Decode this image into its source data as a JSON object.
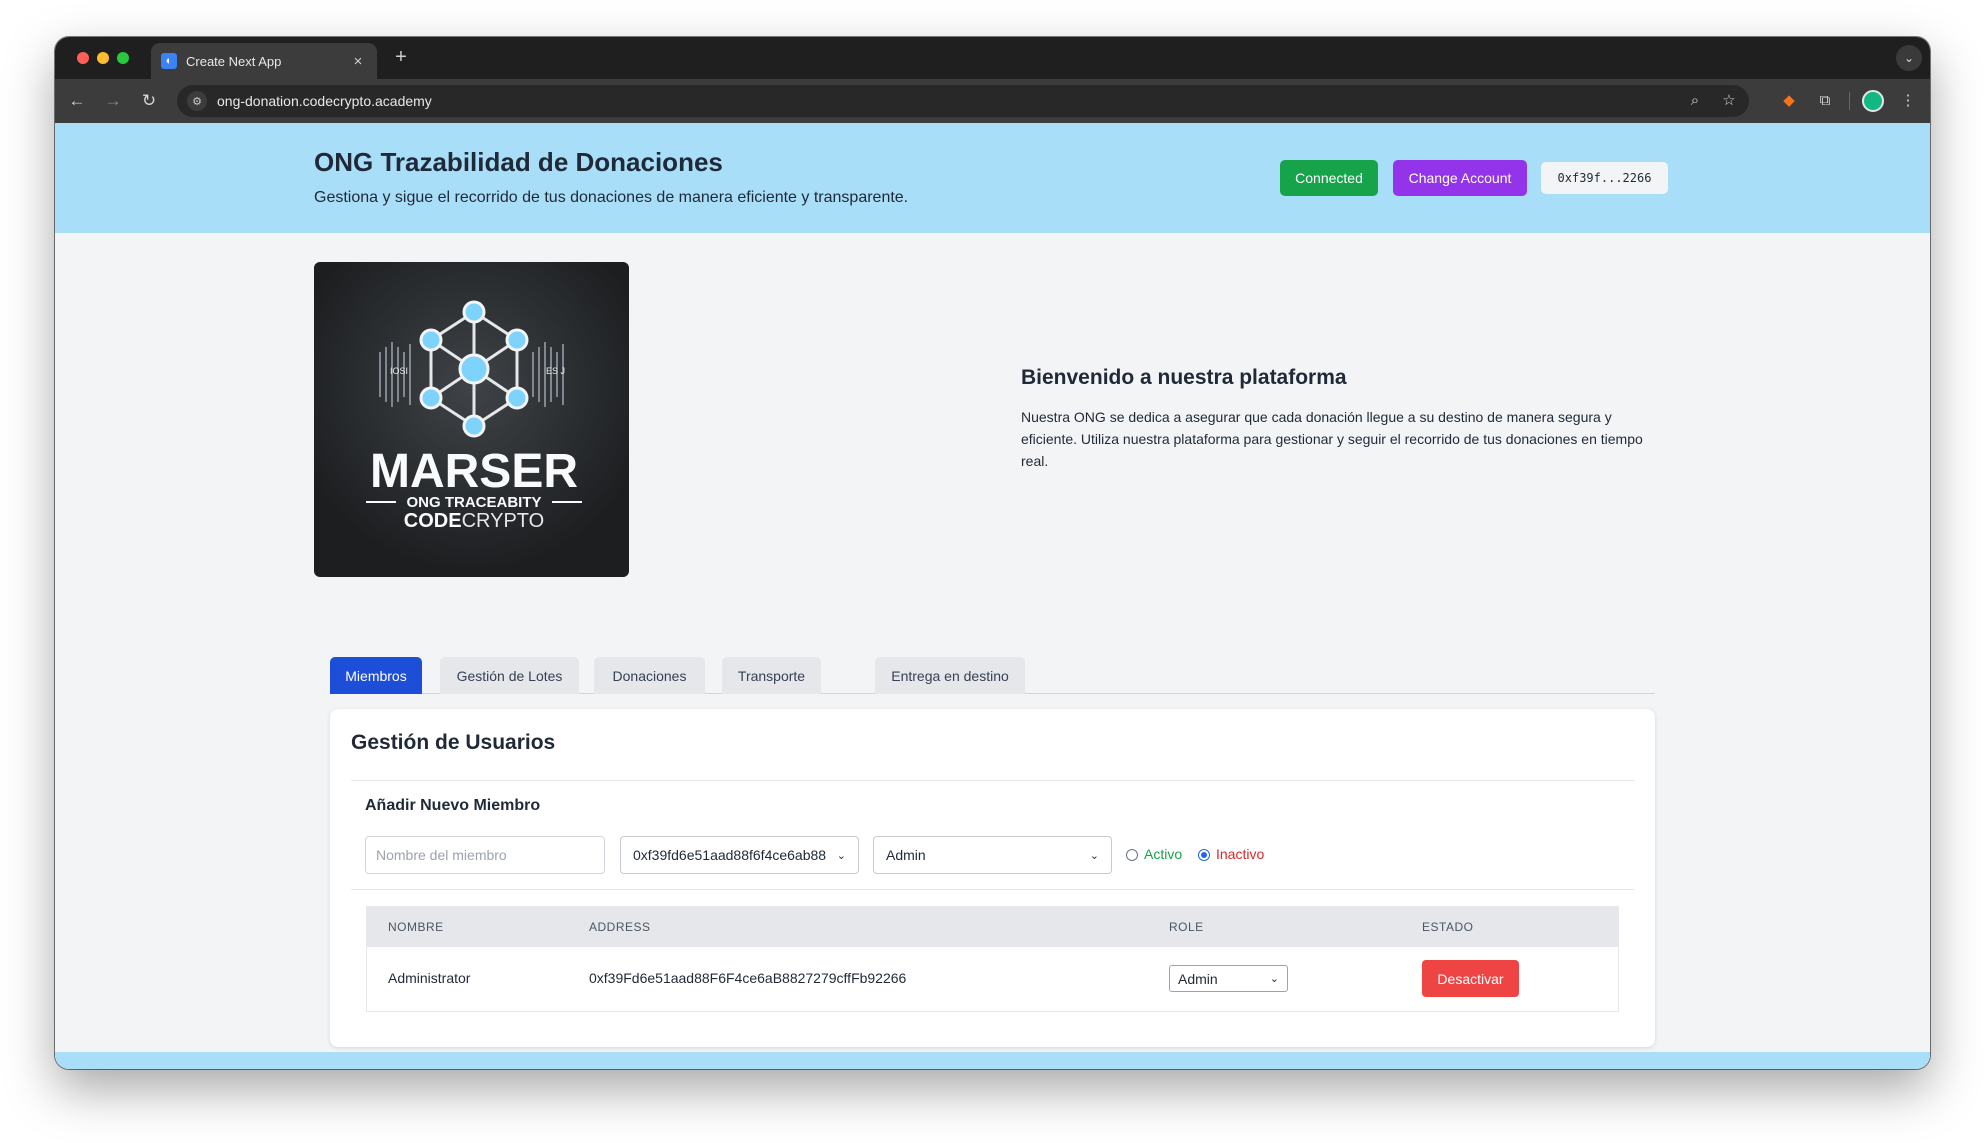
{
  "browser": {
    "tab_title": "Create Next App",
    "tab_close": "×",
    "new_tab": "+",
    "url": "ong-donation.codecrypto.academy"
  },
  "header": {
    "title": "ONG Trazabilidad de Donaciones",
    "subtitle": "Gestiona y sigue el recorrido de tus donaciones de manera eficiente y transparente.",
    "connected_label": "Connected",
    "change_account_label": "Change Account",
    "account_short": "0xf39f...2266"
  },
  "logo": {
    "brand": "MARSER",
    "tagline": "ONG TRACEABITY",
    "sub_bold": "CODE",
    "sub_light": "CRYPTO",
    "left_text": "IOSI",
    "right_text": "ES J"
  },
  "welcome": {
    "title": "Bienvenido a nuestra plataforma",
    "text": "Nuestra ONG se dedica a asegurar que cada donación llegue a su destino de manera segura y eficiente. Utiliza nuestra plataforma para gestionar y seguir el recorrido de tus donaciones en tiempo real."
  },
  "tabs": [
    {
      "label": "Miembros",
      "active": true
    },
    {
      "label": "Gestión de Lotes",
      "active": false
    },
    {
      "label": "Donaciones",
      "active": false
    },
    {
      "label": "Transporte",
      "active": false
    },
    {
      "label": "Entrega en destino",
      "active": false
    }
  ],
  "users": {
    "title": "Gestión de Usuarios",
    "add_title": "Añadir Nuevo Miembro",
    "name_placeholder": "Nombre del miembro",
    "address_selected": "0xf39fd6e51aad88f6f4ce6ab88",
    "role_selected": "Admin",
    "radio_activo": "Activo",
    "radio_inactivo": "Inactivo",
    "radio_selected": "Inactivo",
    "columns": [
      "NOMBRE",
      "ADDRESS",
      "ROLE",
      "ESTADO"
    ],
    "rows": [
      {
        "name": "Administrator",
        "address": "0xf39Fd6e51aad88F6F4ce6aB8827279cffFb92266",
        "role": "Admin",
        "action": "Desactivar"
      }
    ]
  },
  "colors": {
    "header_bg": "#a9def9",
    "connected": "#16a34a",
    "change_account": "#9333ea",
    "active_tab": "#1d4ed8",
    "danger": "#ef4444"
  }
}
